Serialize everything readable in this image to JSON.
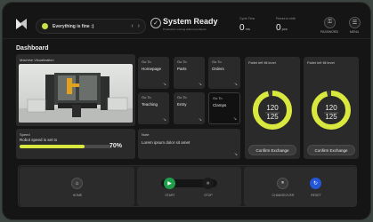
{
  "header": {
    "status_message": "Everything is fine :)",
    "system_title": "System Ready",
    "system_subtitle": "Production running without problems",
    "cycle_time_label": "Cycle Time",
    "cycle_time_value": "0",
    "cycle_time_unit": "ms",
    "pieces_label": "Pieces in shift",
    "pieces_value": "0",
    "pieces_unit": "pcs",
    "password_label": "PASSWORD",
    "menu_label": "MENU"
  },
  "page_title": "Dashboard",
  "machine": {
    "title": "Machine Visualization"
  },
  "nav_cards": [
    {
      "go": "Go To",
      "label": "Homepage"
    },
    {
      "go": "Go To",
      "label": "Parts"
    },
    {
      "go": "Go To",
      "label": "Orders"
    },
    {
      "go": "Go To",
      "label": "Teaching"
    },
    {
      "go": "Go To",
      "label": "Entry"
    },
    {
      "go": "Go To",
      "label": "Clamps"
    }
  ],
  "speed": {
    "title": "Speed",
    "text": "Robot speed is set to",
    "value_label": "70%",
    "value": 0.7
  },
  "notes": {
    "title": "Note",
    "text": "Lorem ipsum dolor sit amet"
  },
  "pallets": [
    {
      "title": "Pallet left fill level",
      "current": "120",
      "max": "125",
      "fraction": 0.96,
      "button": "Confirm Exchange"
    },
    {
      "title": "Pallet left fill level",
      "current": "120",
      "max": "125",
      "fraction": 0.96,
      "button": "Confirm Exchange"
    }
  ],
  "controls": {
    "home_label": "HOME",
    "start_label": "START",
    "stop_label": "STOP",
    "changeover_label": "CHANGEOVER",
    "reset_label": "RESET"
  },
  "colors": {
    "accent": "#d9e83f",
    "start": "#1e9e4a",
    "reset": "#2456d8",
    "card": "#2a2a2a"
  }
}
